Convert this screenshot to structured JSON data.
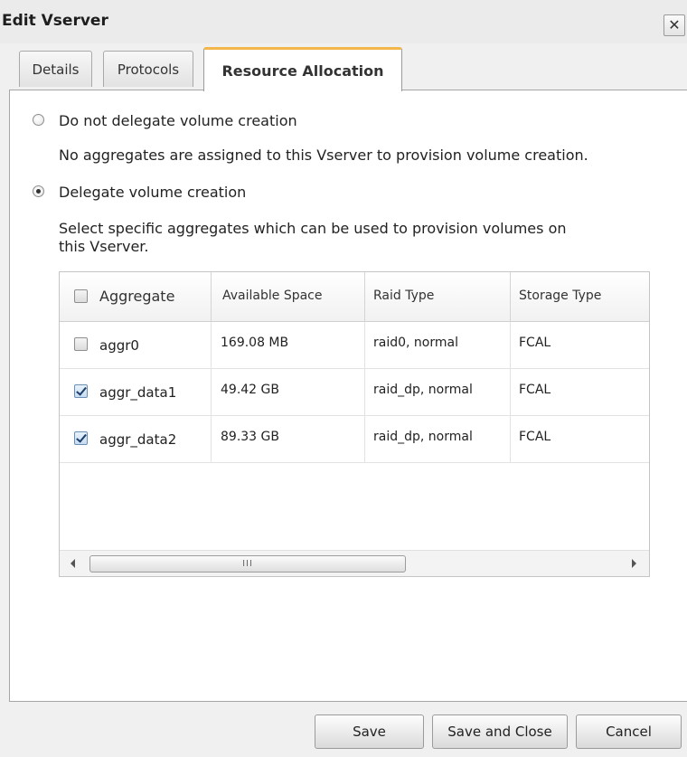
{
  "dialog": {
    "title": "Edit Vserver",
    "close_glyph": "✕"
  },
  "tabs": [
    {
      "label": "Details",
      "active": false
    },
    {
      "label": "Protocols",
      "active": false
    },
    {
      "label": "Resource Allocation",
      "active": true
    }
  ],
  "options": {
    "no_delegate": {
      "label": "Do not delegate volume creation",
      "description": "No aggregates are assigned to this Vserver to provision volume creation.",
      "selected": false
    },
    "delegate": {
      "label": "Delegate volume creation",
      "description_line1": "Select specific aggregates which can be used to provision volumes on",
      "description_line2": "this Vserver.",
      "selected": true
    }
  },
  "grid": {
    "columns": [
      "Aggregate",
      "Available Space",
      "Raid Type",
      "Storage Type"
    ],
    "rows": [
      {
        "aggregate": "aggr0",
        "available_space": "169.08 MB",
        "raid_type": "raid0, normal",
        "storage_type": "FCAL",
        "checked": false
      },
      {
        "aggregate": "aggr_data1",
        "available_space": "49.42 GB",
        "raid_type": "raid_dp, normal",
        "storage_type": "FCAL",
        "checked": true
      },
      {
        "aggregate": "aggr_data2",
        "available_space": "89.33 GB",
        "raid_type": "raid_dp, normal",
        "storage_type": "FCAL",
        "checked": true
      }
    ],
    "scroll_thumb_grip": "III"
  },
  "buttons": {
    "save": "Save",
    "save_and_close": "Save and Close",
    "cancel": "Cancel"
  },
  "colors": {
    "active_tab_accent": "#f3b64b",
    "checkbox_checked": "#1c3e6a"
  }
}
